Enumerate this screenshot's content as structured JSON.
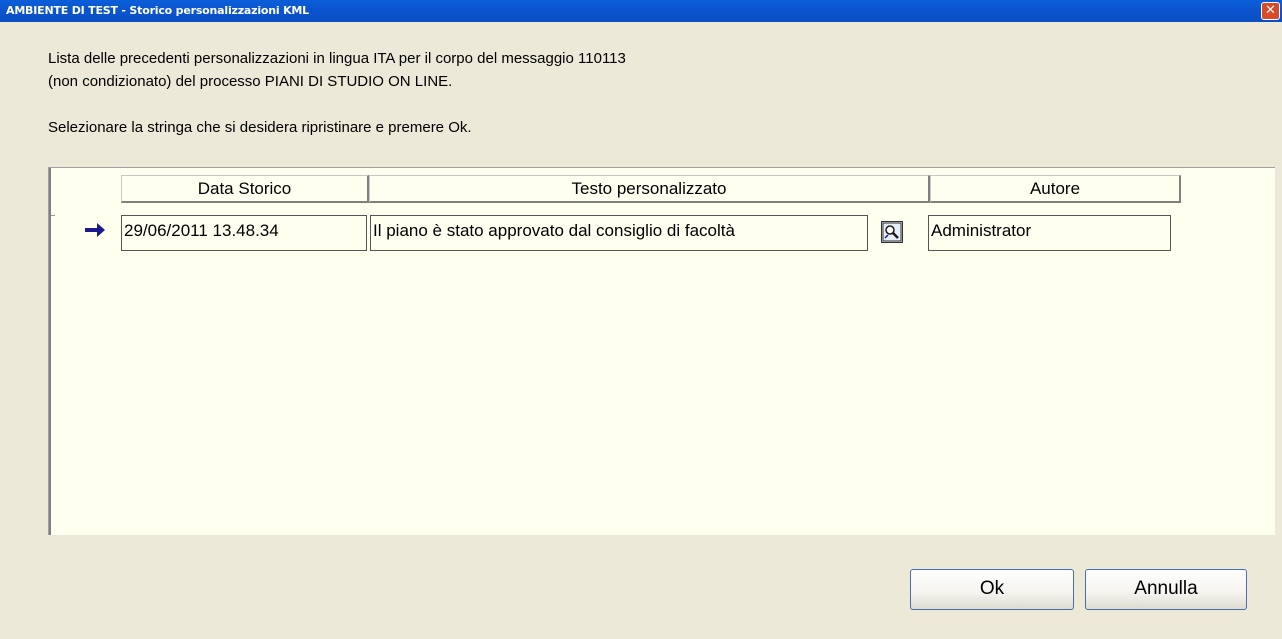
{
  "window": {
    "title": "AMBIENTE DI TEST - Storico personalizzazioni KML",
    "close_glyph": "✕"
  },
  "description": {
    "line1": "Lista delle precedenti personalizzazioni in lingua ITA per il corpo del messaggio 110113",
    "line2": "(non condizionato) del processo PIANI DI STUDIO ON LINE.",
    "instruction": "Selezionare la stringa che si desidera ripristinare e premere Ok."
  },
  "grid": {
    "columns": [
      "Data Storico",
      "Testo personalizzato",
      "Autore"
    ],
    "rows": [
      {
        "date": "29/06/2011 13.48.34",
        "text": "Il piano è stato approvato dal consiglio di facoltà",
        "author": "Administrator",
        "selected": true
      }
    ],
    "row_indicator_icon": "arrow-right-icon",
    "zoom_icon": "zoom-icon"
  },
  "buttons": {
    "ok": "Ok",
    "cancel": "Annulla"
  },
  "colors": {
    "titlebar": "#0a5fd9",
    "grid_bg": "#fffff0",
    "arrow": "#1a1a8c",
    "dialog_bg": "#ece9d8"
  }
}
